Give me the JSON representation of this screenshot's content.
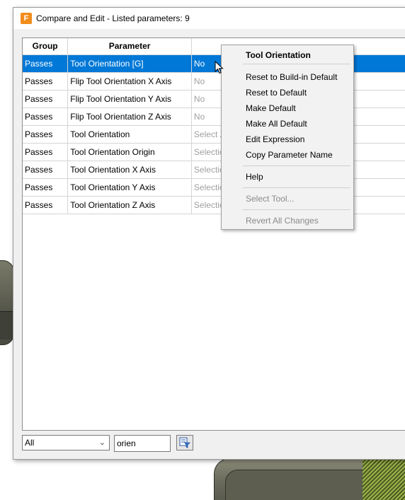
{
  "window": {
    "title": "Compare and Edit - Listed parameters: 9",
    "icon_letter": "F"
  },
  "table": {
    "headers": [
      "Group",
      "Parameter",
      ""
    ],
    "rows": [
      {
        "group": "Passes",
        "parameter": "Tool Orientation [G]",
        "value": "No",
        "selected": true
      },
      {
        "group": "Passes",
        "parameter": "Flip Tool Orientation X Axis",
        "value": "No"
      },
      {
        "group": "Passes",
        "parameter": "Flip Tool Orientation Y Axis",
        "value": "No"
      },
      {
        "group": "Passes",
        "parameter": "Flip Tool Orientation Z Axis",
        "value": "No"
      },
      {
        "group": "Passes",
        "parameter": "Tool Orientation",
        "value": "Select Z"
      },
      {
        "group": "Passes",
        "parameter": "Tool Orientation Origin",
        "value": "Selectio"
      },
      {
        "group": "Passes",
        "parameter": "Tool Orientation X Axis",
        "value": "Selectio"
      },
      {
        "group": "Passes",
        "parameter": "Tool Orientation Y Axis",
        "value": "Selectio"
      },
      {
        "group": "Passes",
        "parameter": "Tool Orientation Z Axis",
        "value": "Selectio"
      }
    ]
  },
  "filter": {
    "selected": "All",
    "search_value": "orien"
  },
  "context_menu": {
    "header": "Tool Orientation",
    "items": [
      {
        "label": "Reset to Build-in Default"
      },
      {
        "label": "Reset to Default"
      },
      {
        "label": "Make Default"
      },
      {
        "label": "Make All Default"
      },
      {
        "label": "Edit Expression"
      },
      {
        "label": "Copy Parameter Name"
      },
      {
        "label": "Help"
      },
      {
        "label": "Select Tool...",
        "disabled": true
      },
      {
        "label": "Revert All Changes",
        "disabled": true
      }
    ]
  },
  "colors": {
    "selection": "#0078d7",
    "accent": "#f28c1c"
  }
}
